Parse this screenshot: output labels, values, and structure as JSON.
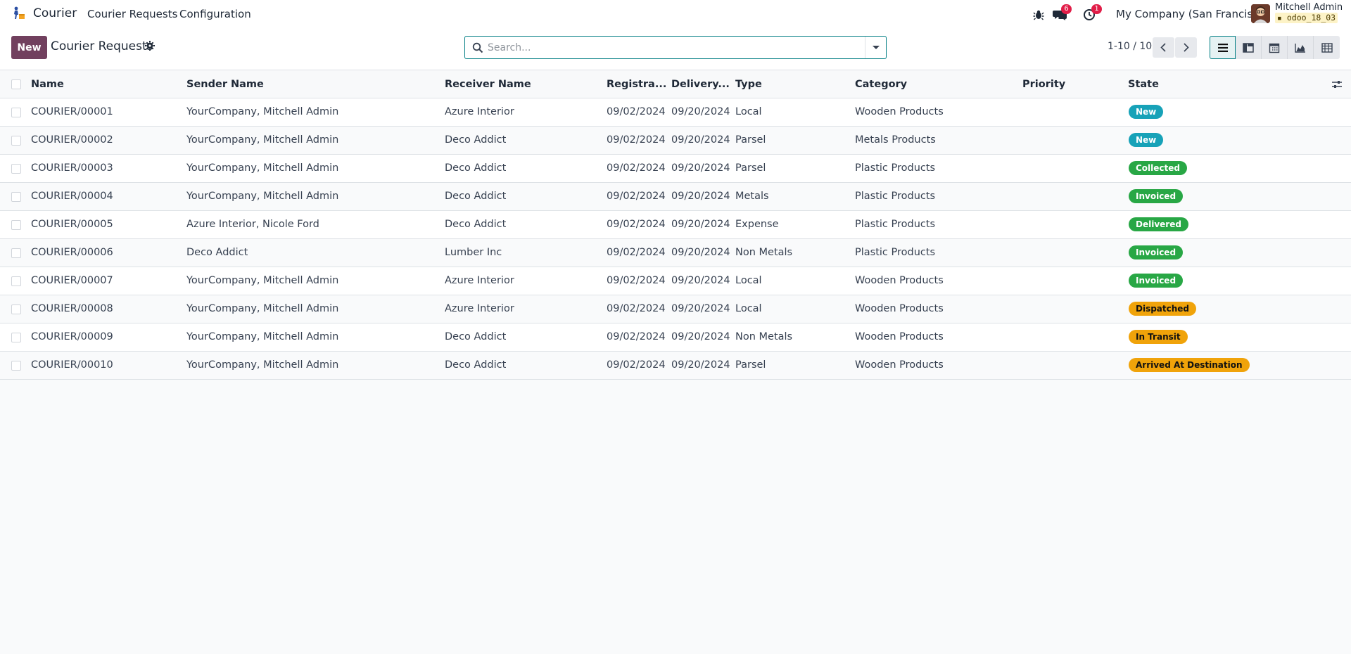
{
  "navbar": {
    "app_name": "Courier",
    "menus": [
      "Courier Requests",
      "Configuration"
    ],
    "icons": [
      "bug-icon",
      "chat-icon",
      "activity-clock-icon"
    ],
    "messages_count": "6",
    "activities_count": "1",
    "company": "My Company (San Francisco)",
    "user_name": "Mitchell Admin",
    "database": "odoo_18_03"
  },
  "control": {
    "new_label": "New",
    "title": "Courier Requests",
    "search_placeholder": "Search...",
    "pager": "1-10 / 10",
    "views": [
      "list-view-icon",
      "kanban-view-icon",
      "calendar-view-icon",
      "graph-view-icon",
      "pivot-view-icon"
    ]
  },
  "table": {
    "headers": {
      "name": "Name",
      "sender": "Sender Name",
      "receiver": "Receiver Name",
      "registration": "Registra...",
      "delivery": "Delivery...",
      "type": "Type",
      "category": "Category",
      "priority": "Priority",
      "state": "State"
    },
    "rows": [
      {
        "name": "COURIER/00001",
        "sender": "YourCompany, Mitchell Admin",
        "receiver": "Azure Interior",
        "registration": "09/02/2024",
        "delivery": "09/20/2024",
        "type": "Local",
        "category": "Wooden Products",
        "state": "New"
      },
      {
        "name": "COURIER/00002",
        "sender": "YourCompany, Mitchell Admin",
        "receiver": "Deco Addict",
        "registration": "09/02/2024",
        "delivery": "09/20/2024",
        "type": "Parsel",
        "category": "Metals Products",
        "state": "New"
      },
      {
        "name": "COURIER/00003",
        "sender": "YourCompany, Mitchell Admin",
        "receiver": "Deco Addict",
        "registration": "09/02/2024",
        "delivery": "09/20/2024",
        "type": "Parsel",
        "category": "Plastic Products",
        "state": "Collected"
      },
      {
        "name": "COURIER/00004",
        "sender": "YourCompany, Mitchell Admin",
        "receiver": "Deco Addict",
        "registration": "09/02/2024",
        "delivery": "09/20/2024",
        "type": "Metals",
        "category": "Plastic Products",
        "state": "Invoiced"
      },
      {
        "name": "COURIER/00005",
        "sender": "Azure Interior, Nicole Ford",
        "receiver": "Deco Addict",
        "registration": "09/02/2024",
        "delivery": "09/20/2024",
        "type": "Expense",
        "category": "Plastic Products",
        "state": "Delivered"
      },
      {
        "name": "COURIER/00006",
        "sender": "Deco Addict",
        "receiver": "Lumber Inc",
        "registration": "09/02/2024",
        "delivery": "09/20/2024",
        "type": "Non Metals",
        "category": "Plastic Products",
        "state": "Invoiced"
      },
      {
        "name": "COURIER/00007",
        "sender": "YourCompany, Mitchell Admin",
        "receiver": "Azure Interior",
        "registration": "09/02/2024",
        "delivery": "09/20/2024",
        "type": "Local",
        "category": "Wooden Products",
        "state": "Invoiced"
      },
      {
        "name": "COURIER/00008",
        "sender": "YourCompany, Mitchell Admin",
        "receiver": "Azure Interior",
        "registration": "09/02/2024",
        "delivery": "09/20/2024",
        "type": "Local",
        "category": "Wooden Products",
        "state": "Dispatched"
      },
      {
        "name": "COURIER/00009",
        "sender": "YourCompany, Mitchell Admin",
        "receiver": "Deco Addict",
        "registration": "09/02/2024",
        "delivery": "09/20/2024",
        "type": "Non Metals",
        "category": "Wooden Products",
        "state": "In Transit"
      },
      {
        "name": "COURIER/00010",
        "sender": "YourCompany, Mitchell Admin",
        "receiver": "Deco Addict",
        "registration": "09/02/2024",
        "delivery": "09/20/2024",
        "type": "Parsel",
        "category": "Wooden Products",
        "state": "Arrived At Destination"
      }
    ]
  },
  "state_colors": {
    "New": {
      "bg": "#17a2b8",
      "fg": "#ffffff"
    },
    "Collected": {
      "bg": "#28a745",
      "fg": "#ffffff"
    },
    "Invoiced": {
      "bg": "#28a745",
      "fg": "#ffffff"
    },
    "Delivered": {
      "bg": "#28a745",
      "fg": "#ffffff"
    },
    "Dispatched": {
      "bg": "#f0a30a",
      "fg": "#111111"
    },
    "In Transit": {
      "bg": "#f0a30a",
      "fg": "#111111"
    },
    "Arrived At Destination": {
      "bg": "#f0a30a",
      "fg": "#111111"
    }
  },
  "colors": {
    "brand": "#71405e",
    "accent": "#017e84",
    "notification": "#e11d48"
  }
}
